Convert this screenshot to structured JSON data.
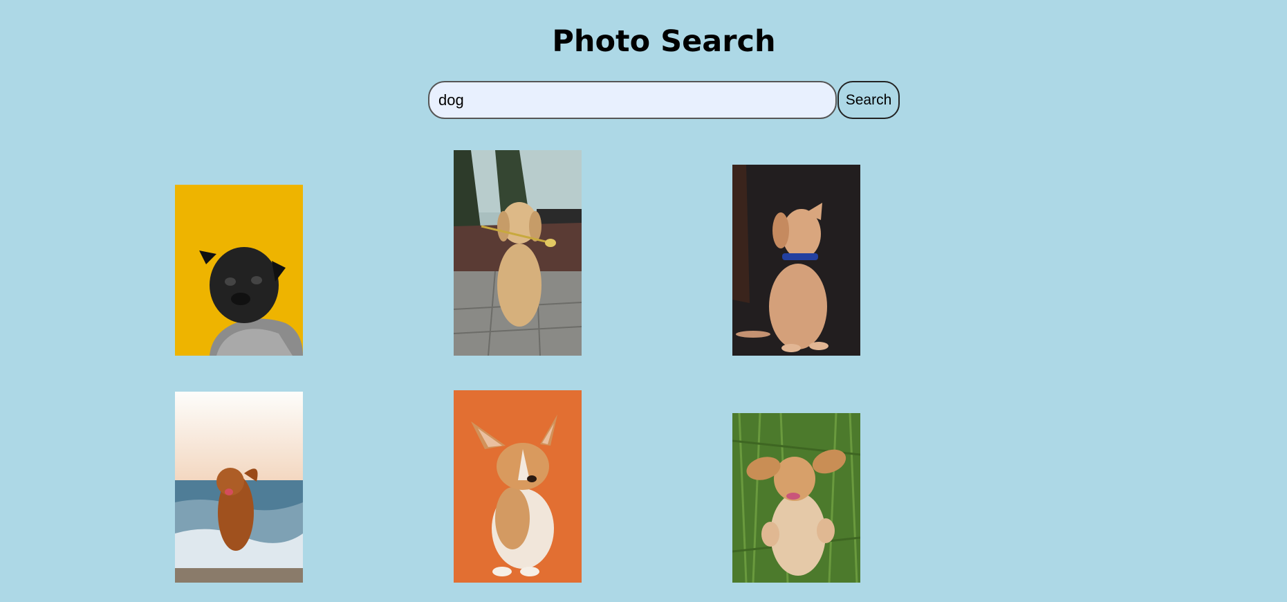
{
  "header": {
    "title": "Photo Search"
  },
  "search": {
    "value": "dog",
    "button_label": "Search"
  },
  "results": [
    {
      "name": "pug-photo"
    },
    {
      "name": "golden-retriever-photo"
    },
    {
      "name": "labrador-puppy-photo"
    },
    {
      "name": "beach-dog-photo"
    },
    {
      "name": "corgi-puppy-photo"
    },
    {
      "name": "spaniel-grass-photo"
    }
  ]
}
